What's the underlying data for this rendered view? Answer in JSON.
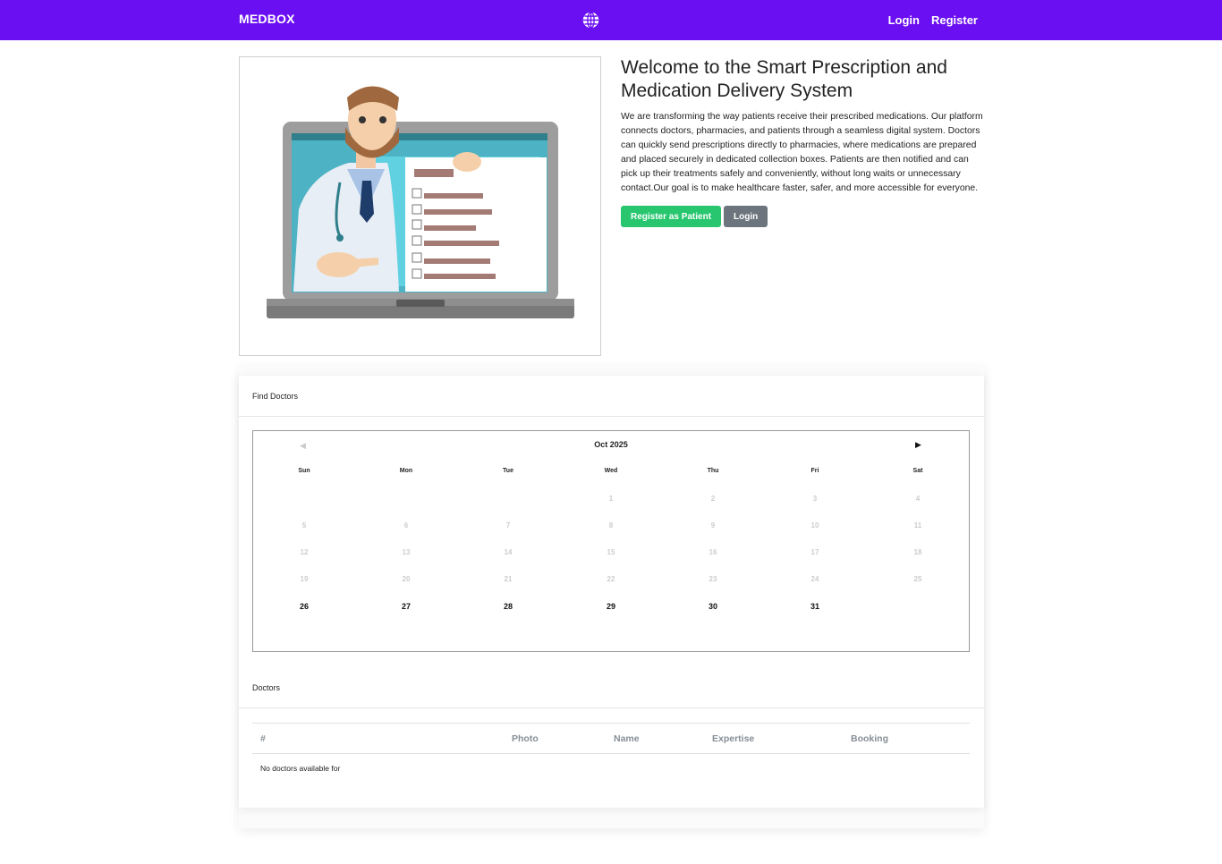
{
  "navbar": {
    "brand": "MEDBOX",
    "globe_icon": "globe-icon",
    "login": "Login",
    "register": "Register",
    "background": "#6a0ff2"
  },
  "hero": {
    "title": "Welcome to the Smart Prescription and Medication Delivery System",
    "description": "We are transforming the way patients receive their prescribed medications. Our platform connects doctors, pharmacies, and patients through a seamless digital system. Doctors can quickly send prescriptions directly to pharmacies, where medications are prepared and placed securely in dedicated collection boxes. Patients are then notified and can pick up their treatments safely and conveniently, without long waits or unnecessary contact.Our goal is to make healthcare faster, safer, and more accessible for everyone.",
    "register_button": "Register as Patient",
    "login_button": "Login"
  },
  "find_doctors": {
    "header": "Find Doctors",
    "calendar": {
      "month_label": "Oct 2025",
      "prev_icon": "◀",
      "next_icon": "▶",
      "weekdays": [
        "Sun",
        "Mon",
        "Tue",
        "Wed",
        "Thu",
        "Fri",
        "Sat"
      ],
      "weeks": [
        [
          "",
          "",
          "",
          "1",
          "2",
          "3",
          "4"
        ],
        [
          "5",
          "6",
          "7",
          "8",
          "9",
          "10",
          "11"
        ],
        [
          "12",
          "13",
          "14",
          "15",
          "16",
          "17",
          "18"
        ],
        [
          "19",
          "20",
          "21",
          "22",
          "23",
          "24",
          "25"
        ],
        [
          "26",
          "27",
          "28",
          "29",
          "30",
          "31",
          ""
        ]
      ],
      "first_available_day": 26
    }
  },
  "doctors": {
    "header": "Doctors",
    "columns": [
      "#",
      "Photo",
      "Name",
      "Expertise",
      "Booking"
    ],
    "empty_message": "No doctors available for"
  },
  "colors": {
    "accent": "#6a0ff2",
    "success": "#28c76f",
    "secondary": "#6c757d"
  }
}
